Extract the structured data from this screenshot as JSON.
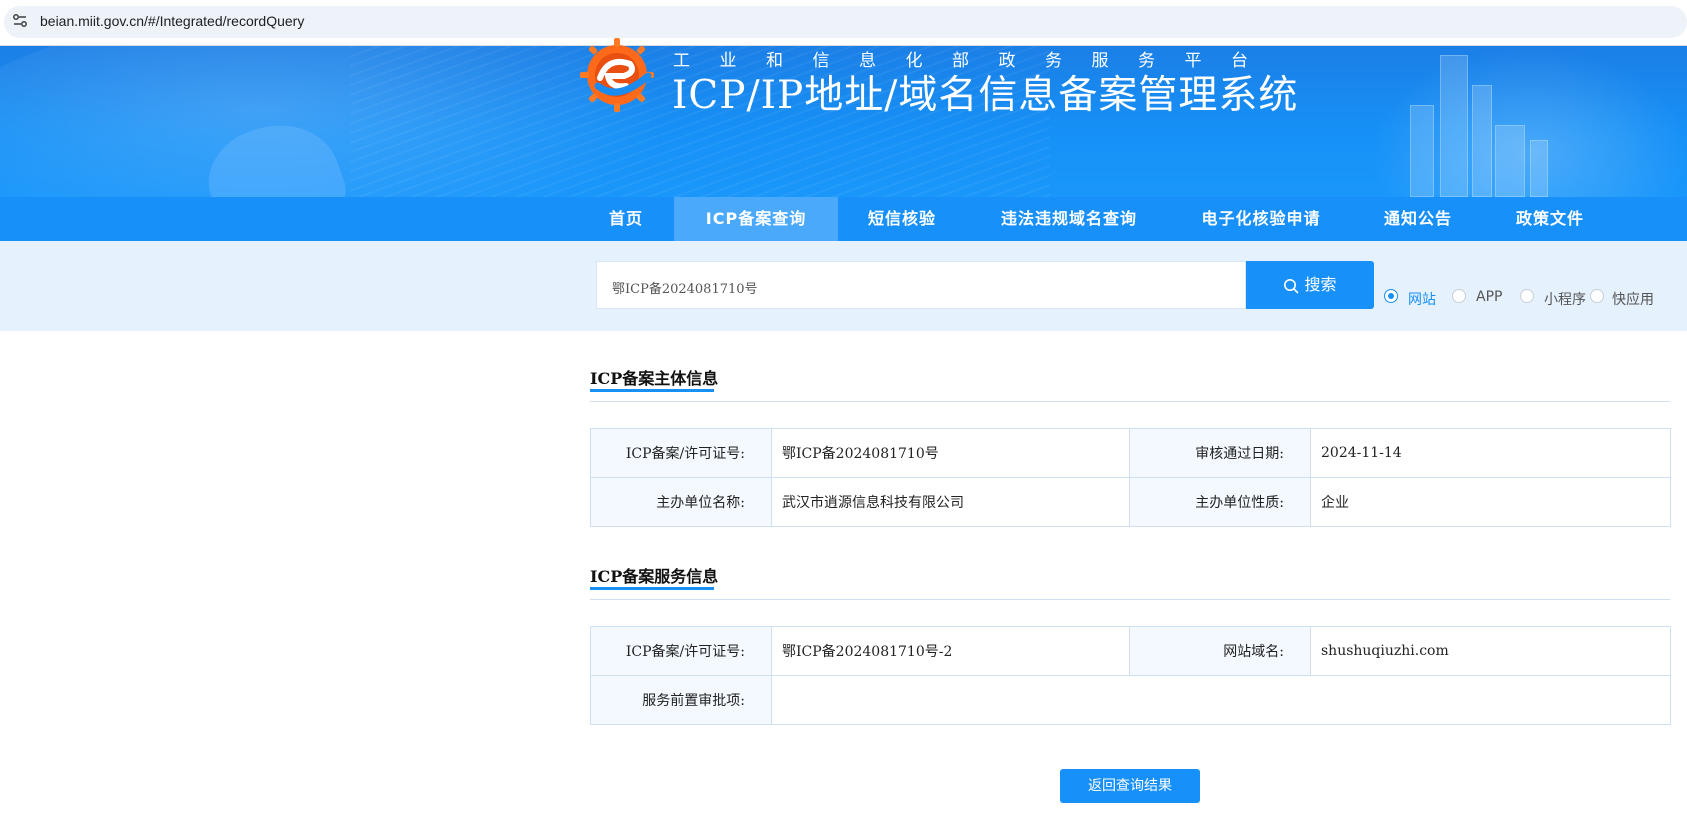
{
  "browser": {
    "url": "beian.miit.gov.cn/#/Integrated/recordQuery"
  },
  "header": {
    "subtitle": "工业和信息化部政务服务平台",
    "title": "ICP/IP地址/域名信息备案管理系统"
  },
  "nav": {
    "items": [
      {
        "label": "首页",
        "active": false
      },
      {
        "label": "ICP备案查询",
        "active": true
      },
      {
        "label": "短信核验",
        "active": false
      },
      {
        "label": "违法违规域名查询",
        "active": false
      },
      {
        "label": "电子化核验申请",
        "active": false
      },
      {
        "label": "通知公告",
        "active": false
      },
      {
        "label": "政策文件",
        "active": false
      }
    ]
  },
  "search": {
    "value": "鄂ICP备2024081710号",
    "button_label": "搜索",
    "options": [
      {
        "label": "网站",
        "checked": true
      },
      {
        "label": "APP",
        "checked": false
      },
      {
        "label": "小程序",
        "checked": false
      },
      {
        "label": "快应用",
        "checked": false
      }
    ]
  },
  "subject_section": {
    "title": "ICP备案主体信息",
    "rows": [
      {
        "label1": "ICP备案/许可证号:",
        "value1": "鄂ICP备2024081710号",
        "label2": "审核通过日期:",
        "value2": "2024-11-14"
      },
      {
        "label1": "主办单位名称:",
        "value1": "武汉市逍源信息科技有限公司",
        "label2": "主办单位性质:",
        "value2": "企业"
      }
    ]
  },
  "service_section": {
    "title": "ICP备案服务信息",
    "row1": {
      "label1": "ICP备案/许可证号:",
      "value1": "鄂ICP备2024081710号-2",
      "label2": "网站域名:",
      "value2": "shushuqiuzhi.com"
    },
    "row2": {
      "label1": "服务前置审批项:",
      "value1": ""
    }
  },
  "back_button": "返回查询结果",
  "colors": {
    "primary": "#1890fa",
    "nav_active": "#4aa9fb",
    "search_strip": "#e5f1fd",
    "label_cell": "#f4f9ff",
    "border": "#cfe0f3"
  }
}
